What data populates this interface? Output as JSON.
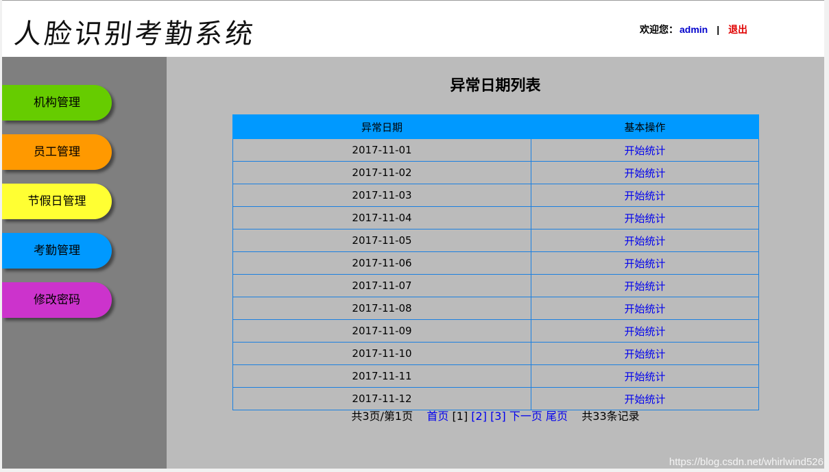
{
  "header": {
    "logo_text": "人脸识别考勤系统",
    "welcome_label": "欢迎您：",
    "username": "admin",
    "separator": "|",
    "logout_label": "退出"
  },
  "sidebar": {
    "items": [
      {
        "label": "机构管理",
        "color": "#66cc00"
      },
      {
        "label": "员工管理",
        "color": "#ff9900"
      },
      {
        "label": "节假日管理",
        "color": "#ffff33"
      },
      {
        "label": "考勤管理",
        "color": "#0099ff"
      },
      {
        "label": "修改密码",
        "color": "#cc33cc"
      }
    ]
  },
  "main": {
    "title": "异常日期列表",
    "columns": [
      "异常日期",
      "基本操作"
    ],
    "rows": [
      {
        "date": "2017-11-01",
        "action": "开始统计"
      },
      {
        "date": "2017-11-02",
        "action": "开始统计"
      },
      {
        "date": "2017-11-03",
        "action": "开始统计"
      },
      {
        "date": "2017-11-04",
        "action": "开始统计"
      },
      {
        "date": "2017-11-05",
        "action": "开始统计"
      },
      {
        "date": "2017-11-06",
        "action": "开始统计"
      },
      {
        "date": "2017-11-07",
        "action": "开始统计"
      },
      {
        "date": "2017-11-08",
        "action": "开始统计"
      },
      {
        "date": "2017-11-09",
        "action": "开始统计"
      },
      {
        "date": "2017-11-10",
        "action": "开始统计"
      },
      {
        "date": "2017-11-11",
        "action": "开始统计"
      },
      {
        "date": "2017-11-12",
        "action": "开始统计"
      }
    ]
  },
  "pager": {
    "summary": "共3页/第1页",
    "first": "首页",
    "current": "[1]",
    "page2": "[2]",
    "page3": "[3]",
    "next": "下一页",
    "last": "尾页",
    "total": "共33条记录"
  },
  "watermark": "https://blog.csdn.net/whirlwind526"
}
